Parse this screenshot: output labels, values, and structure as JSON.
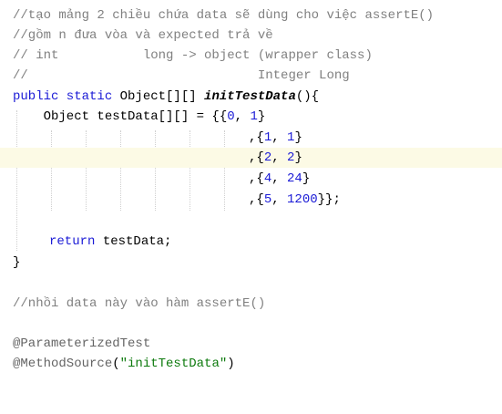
{
  "code": {
    "comment_line_1": "//tạo mảng 2 chiều chứa data sẽ dùng cho việc assertE()",
    "comment_line_2": "//gồm n đưa vòa và expected trả về",
    "comment_line_3": "// int           long -> object (wrapper class)",
    "comment_line_4": "//                              Integer Long",
    "kw_public_static": "public static",
    "return_type": " Object[][] ",
    "method_name": "initTestData",
    "method_tail": "(){",
    "decl_prefix": "    Object testData[][] = {{",
    "row0_a": "0",
    "row0_sep": ", ",
    "row0_b": "1",
    "row0_close": "}",
    "row1_open": ",{",
    "row1_a": "1",
    "row1_sep": ", ",
    "row1_b": "1",
    "row1_close": "}",
    "row2_open": ",{",
    "row2_a": "2",
    "row2_sep": ", ",
    "row2_b": "2",
    "row2_close": "}",
    "row3_open": ",{",
    "row3_a": "4",
    "row3_sep": ", ",
    "row3_b": "24",
    "row3_close": "}",
    "row4_open": ",{",
    "row4_a": "5",
    "row4_sep": ", ",
    "row4_b": "1200",
    "row4_close": "}};",
    "return_kw": "return",
    "return_tail": " testData;",
    "close_brace": "}",
    "comment_line_5": "//nhồi data này vào hàm assertE()",
    "annotation_1": "@ParameterizedTest",
    "annotation_2_name": "@MethodSource",
    "annotation_2_open": "(",
    "annotation_2_value": "\"initTestData\"",
    "annotation_2_close": ")"
  },
  "colors": {
    "comment": "#808080",
    "keyword": "#1a1ad6",
    "number": "#1a1ad6",
    "string": "#0d7a0d",
    "annotation": "#646464",
    "current_line_highlight": "#fcfae5"
  }
}
